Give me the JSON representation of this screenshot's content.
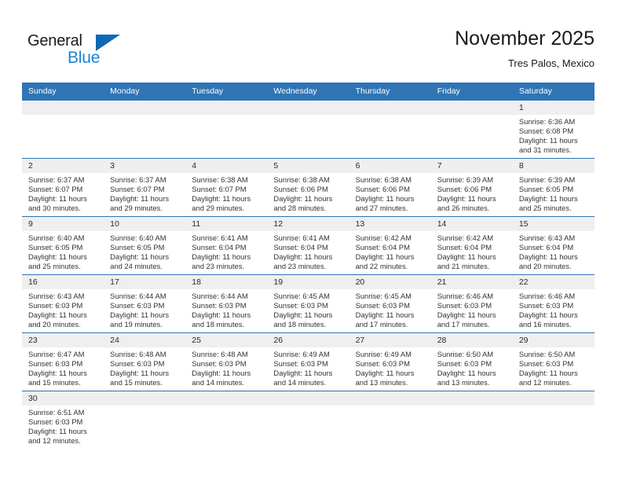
{
  "brand": {
    "name_top": "General",
    "name_bottom": "Blue",
    "triangle_color": "#1168b3",
    "blue_text_color": "#1c84d4"
  },
  "header": {
    "title": "November 2025",
    "subtitle": "Tres Palos, Mexico"
  },
  "theme": {
    "header_blue": "#2f74b5",
    "daynum_band": "#efefef",
    "text": "#333333"
  },
  "weekday_headers": [
    "Sunday",
    "Monday",
    "Tuesday",
    "Wednesday",
    "Thursday",
    "Friday",
    "Saturday"
  ],
  "weeks": [
    [
      {
        "day": "",
        "blank": true
      },
      {
        "day": "",
        "blank": true
      },
      {
        "day": "",
        "blank": true
      },
      {
        "day": "",
        "blank": true
      },
      {
        "day": "",
        "blank": true
      },
      {
        "day": "",
        "blank": true
      },
      {
        "day": "1",
        "sunrise": "Sunrise: 6:36 AM",
        "sunset": "Sunset: 6:08 PM",
        "daylight_1": "Daylight: 11 hours",
        "daylight_2": "and 31 minutes."
      }
    ],
    [
      {
        "day": "2",
        "sunrise": "Sunrise: 6:37 AM",
        "sunset": "Sunset: 6:07 PM",
        "daylight_1": "Daylight: 11 hours",
        "daylight_2": "and 30 minutes."
      },
      {
        "day": "3",
        "sunrise": "Sunrise: 6:37 AM",
        "sunset": "Sunset: 6:07 PM",
        "daylight_1": "Daylight: 11 hours",
        "daylight_2": "and 29 minutes."
      },
      {
        "day": "4",
        "sunrise": "Sunrise: 6:38 AM",
        "sunset": "Sunset: 6:07 PM",
        "daylight_1": "Daylight: 11 hours",
        "daylight_2": "and 29 minutes."
      },
      {
        "day": "5",
        "sunrise": "Sunrise: 6:38 AM",
        "sunset": "Sunset: 6:06 PM",
        "daylight_1": "Daylight: 11 hours",
        "daylight_2": "and 28 minutes."
      },
      {
        "day": "6",
        "sunrise": "Sunrise: 6:38 AM",
        "sunset": "Sunset: 6:06 PM",
        "daylight_1": "Daylight: 11 hours",
        "daylight_2": "and 27 minutes."
      },
      {
        "day": "7",
        "sunrise": "Sunrise: 6:39 AM",
        "sunset": "Sunset: 6:06 PM",
        "daylight_1": "Daylight: 11 hours",
        "daylight_2": "and 26 minutes."
      },
      {
        "day": "8",
        "sunrise": "Sunrise: 6:39 AM",
        "sunset": "Sunset: 6:05 PM",
        "daylight_1": "Daylight: 11 hours",
        "daylight_2": "and 25 minutes."
      }
    ],
    [
      {
        "day": "9",
        "sunrise": "Sunrise: 6:40 AM",
        "sunset": "Sunset: 6:05 PM",
        "daylight_1": "Daylight: 11 hours",
        "daylight_2": "and 25 minutes."
      },
      {
        "day": "10",
        "sunrise": "Sunrise: 6:40 AM",
        "sunset": "Sunset: 6:05 PM",
        "daylight_1": "Daylight: 11 hours",
        "daylight_2": "and 24 minutes."
      },
      {
        "day": "11",
        "sunrise": "Sunrise: 6:41 AM",
        "sunset": "Sunset: 6:04 PM",
        "daylight_1": "Daylight: 11 hours",
        "daylight_2": "and 23 minutes."
      },
      {
        "day": "12",
        "sunrise": "Sunrise: 6:41 AM",
        "sunset": "Sunset: 6:04 PM",
        "daylight_1": "Daylight: 11 hours",
        "daylight_2": "and 23 minutes."
      },
      {
        "day": "13",
        "sunrise": "Sunrise: 6:42 AM",
        "sunset": "Sunset: 6:04 PM",
        "daylight_1": "Daylight: 11 hours",
        "daylight_2": "and 22 minutes."
      },
      {
        "day": "14",
        "sunrise": "Sunrise: 6:42 AM",
        "sunset": "Sunset: 6:04 PM",
        "daylight_1": "Daylight: 11 hours",
        "daylight_2": "and 21 minutes."
      },
      {
        "day": "15",
        "sunrise": "Sunrise: 6:43 AM",
        "sunset": "Sunset: 6:04 PM",
        "daylight_1": "Daylight: 11 hours",
        "daylight_2": "and 20 minutes."
      }
    ],
    [
      {
        "day": "16",
        "sunrise": "Sunrise: 6:43 AM",
        "sunset": "Sunset: 6:03 PM",
        "daylight_1": "Daylight: 11 hours",
        "daylight_2": "and 20 minutes."
      },
      {
        "day": "17",
        "sunrise": "Sunrise: 6:44 AM",
        "sunset": "Sunset: 6:03 PM",
        "daylight_1": "Daylight: 11 hours",
        "daylight_2": "and 19 minutes."
      },
      {
        "day": "18",
        "sunrise": "Sunrise: 6:44 AM",
        "sunset": "Sunset: 6:03 PM",
        "daylight_1": "Daylight: 11 hours",
        "daylight_2": "and 18 minutes."
      },
      {
        "day": "19",
        "sunrise": "Sunrise: 6:45 AM",
        "sunset": "Sunset: 6:03 PM",
        "daylight_1": "Daylight: 11 hours",
        "daylight_2": "and 18 minutes."
      },
      {
        "day": "20",
        "sunrise": "Sunrise: 6:45 AM",
        "sunset": "Sunset: 6:03 PM",
        "daylight_1": "Daylight: 11 hours",
        "daylight_2": "and 17 minutes."
      },
      {
        "day": "21",
        "sunrise": "Sunrise: 6:46 AM",
        "sunset": "Sunset: 6:03 PM",
        "daylight_1": "Daylight: 11 hours",
        "daylight_2": "and 17 minutes."
      },
      {
        "day": "22",
        "sunrise": "Sunrise: 6:46 AM",
        "sunset": "Sunset: 6:03 PM",
        "daylight_1": "Daylight: 11 hours",
        "daylight_2": "and 16 minutes."
      }
    ],
    [
      {
        "day": "23",
        "sunrise": "Sunrise: 6:47 AM",
        "sunset": "Sunset: 6:03 PM",
        "daylight_1": "Daylight: 11 hours",
        "daylight_2": "and 15 minutes."
      },
      {
        "day": "24",
        "sunrise": "Sunrise: 6:48 AM",
        "sunset": "Sunset: 6:03 PM",
        "daylight_1": "Daylight: 11 hours",
        "daylight_2": "and 15 minutes."
      },
      {
        "day": "25",
        "sunrise": "Sunrise: 6:48 AM",
        "sunset": "Sunset: 6:03 PM",
        "daylight_1": "Daylight: 11 hours",
        "daylight_2": "and 14 minutes."
      },
      {
        "day": "26",
        "sunrise": "Sunrise: 6:49 AM",
        "sunset": "Sunset: 6:03 PM",
        "daylight_1": "Daylight: 11 hours",
        "daylight_2": "and 14 minutes."
      },
      {
        "day": "27",
        "sunrise": "Sunrise: 6:49 AM",
        "sunset": "Sunset: 6:03 PM",
        "daylight_1": "Daylight: 11 hours",
        "daylight_2": "and 13 minutes."
      },
      {
        "day": "28",
        "sunrise": "Sunrise: 6:50 AM",
        "sunset": "Sunset: 6:03 PM",
        "daylight_1": "Daylight: 11 hours",
        "daylight_2": "and 13 minutes."
      },
      {
        "day": "29",
        "sunrise": "Sunrise: 6:50 AM",
        "sunset": "Sunset: 6:03 PM",
        "daylight_1": "Daylight: 11 hours",
        "daylight_2": "and 12 minutes."
      }
    ],
    [
      {
        "day": "30",
        "sunrise": "Sunrise: 6:51 AM",
        "sunset": "Sunset: 6:03 PM",
        "daylight_1": "Daylight: 11 hours",
        "daylight_2": "and 12 minutes."
      },
      {
        "day": "",
        "blank": true
      },
      {
        "day": "",
        "blank": true
      },
      {
        "day": "",
        "blank": true
      },
      {
        "day": "",
        "blank": true
      },
      {
        "day": "",
        "blank": true
      },
      {
        "day": "",
        "blank": true
      }
    ]
  ]
}
